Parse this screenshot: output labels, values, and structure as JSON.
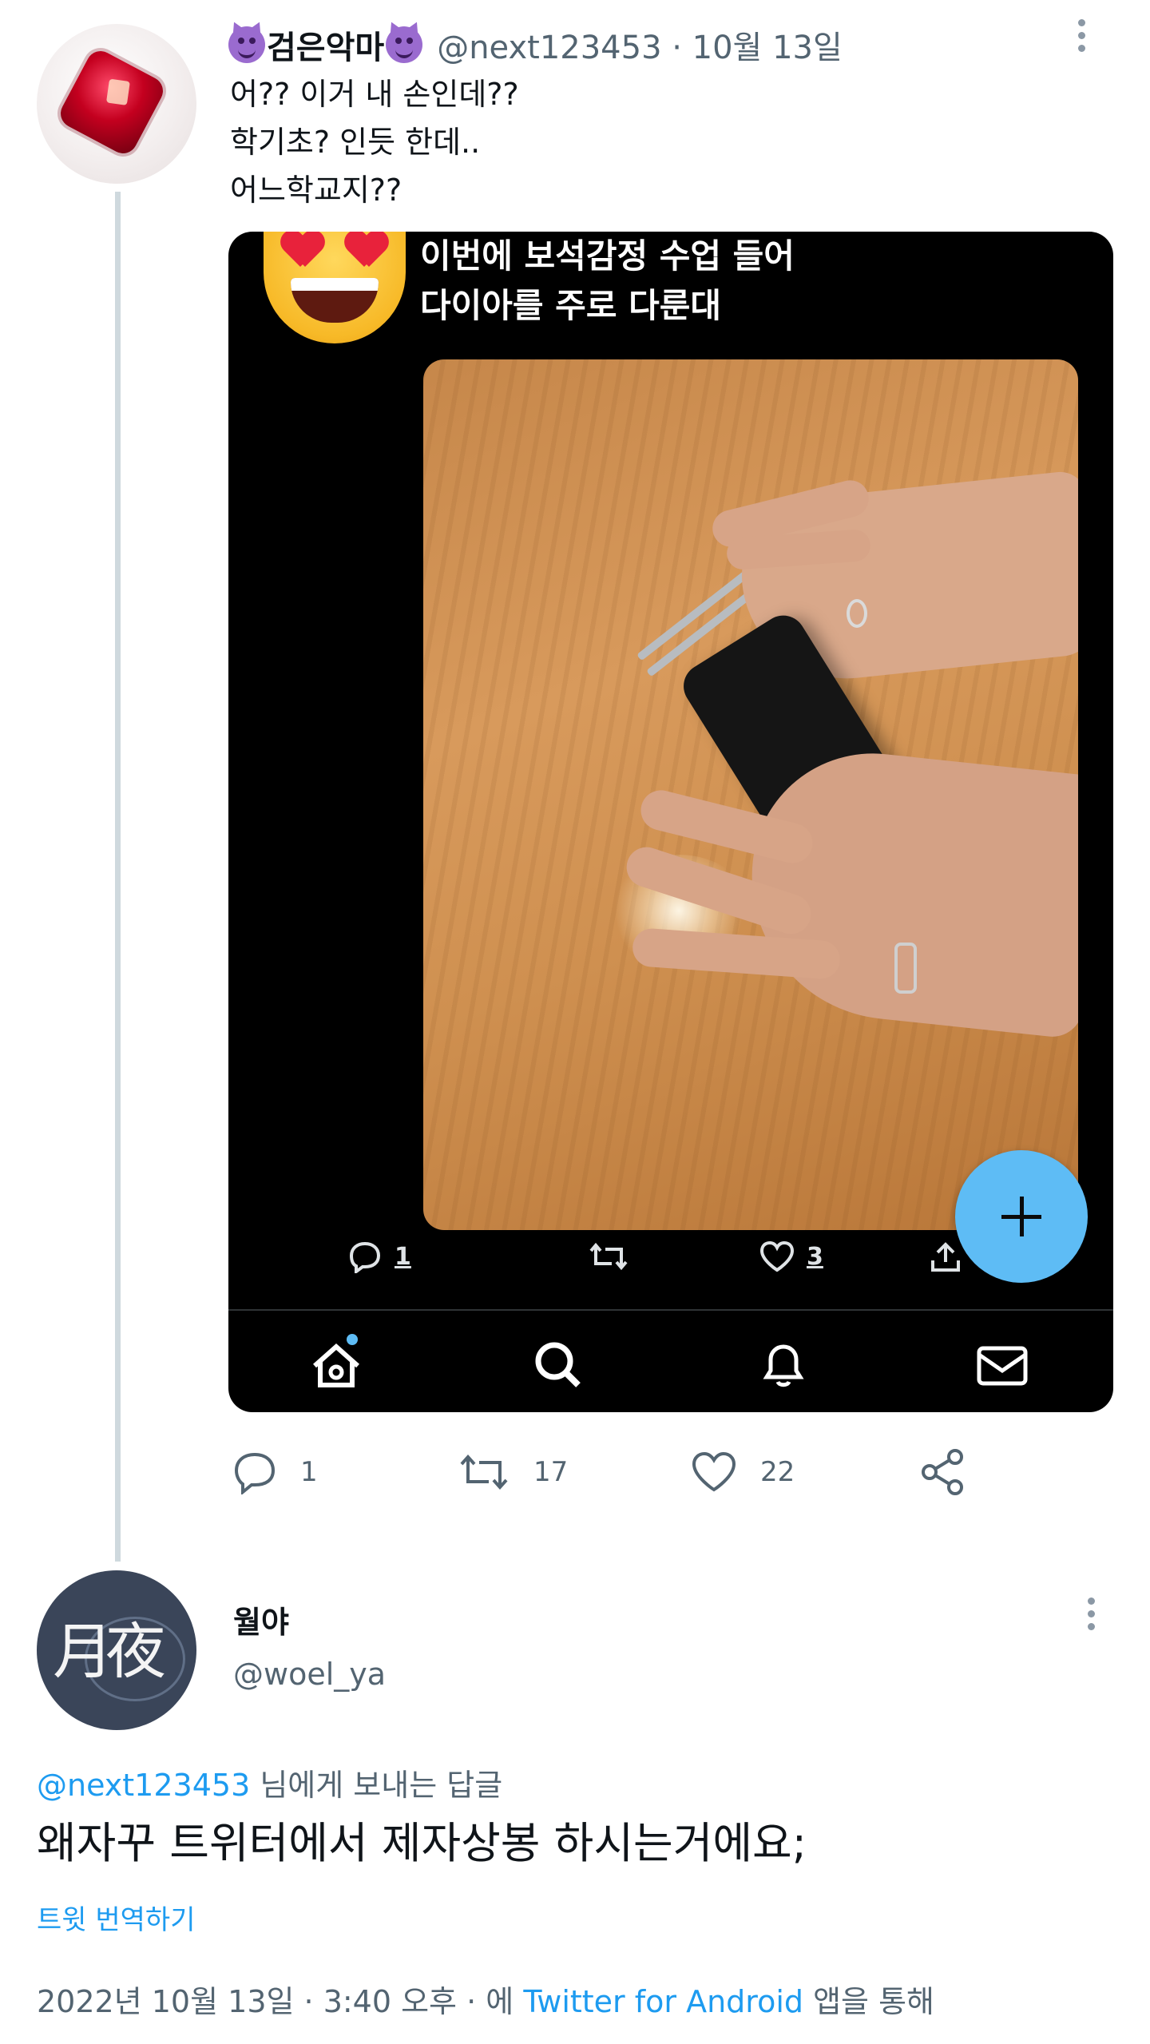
{
  "tweet": {
    "display_name": "검은악마",
    "handle_date": "@next123453 · 10월 13일",
    "lines": [
      "어?? 이거 내 손인데??",
      "학기초? 인듯 한데..",
      "어느학교지??"
    ],
    "embedded": {
      "caption_line1": "이번에 보석감정 수업 들어",
      "caption_line2": "다이아를 주로 다룬대",
      "reply_count": "1",
      "like_count": "3"
    },
    "actions": {
      "replies": "1",
      "retweets": "17",
      "likes": "22"
    }
  },
  "reply": {
    "display_name": "월야",
    "handle": "@woel_ya",
    "replying_to_link": "@next123453",
    "replying_to_suffix": " 님에게 보내는 답글",
    "text": "왜자꾸 트위터에서 제자상봉 하시는거에요;",
    "translate_label": "트윗 번역하기",
    "timestamp_prefix": "2022년 10월 13일 · 3:40 오후 · 에 ",
    "source_link": "Twitter for Android",
    "timestamp_suffix": " 앱을 통해",
    "avatar_glyph": "月夜"
  },
  "colors": {
    "link": "#1d9bf0",
    "muted": "#536471",
    "fab": "#5ebcf5",
    "thread_line": "#cfd9de"
  }
}
